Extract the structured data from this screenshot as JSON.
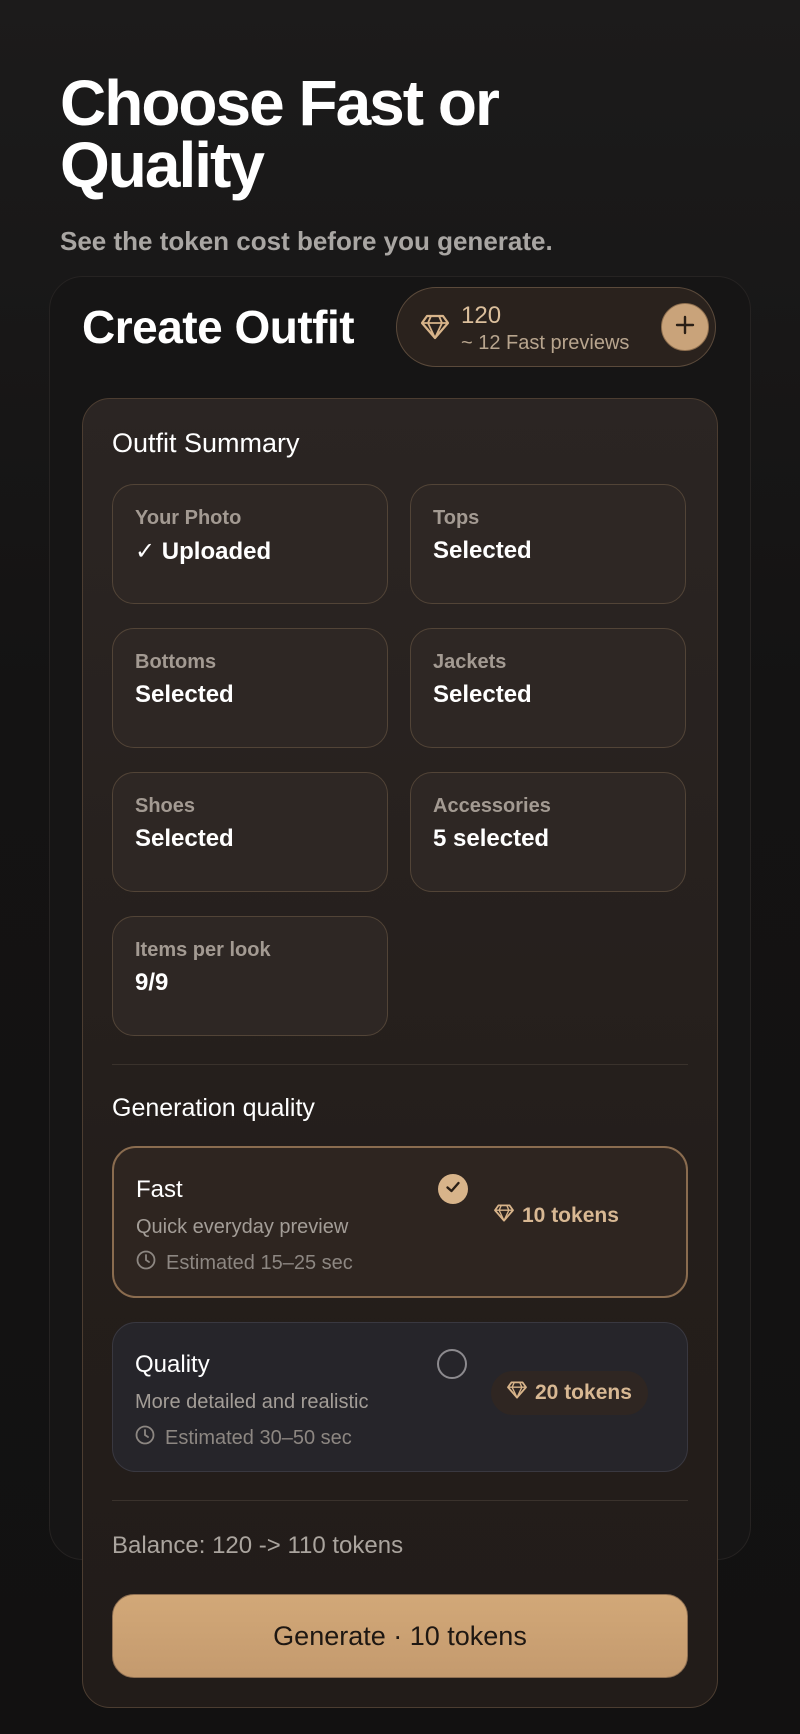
{
  "hero": {
    "title": "Choose Fast or Quality",
    "subtitle": "See the token cost before you generate."
  },
  "screen": {
    "title": "Create Outfit"
  },
  "balance": {
    "amount": "120",
    "note": "~ 12 Fast previews",
    "add_icon": "plus-icon"
  },
  "summary": {
    "title": "Outfit Summary",
    "tiles": [
      {
        "label": "Your Photo",
        "value": "✓ Uploaded"
      },
      {
        "label": "Tops",
        "value": "Selected"
      },
      {
        "label": "Bottoms",
        "value": "Selected"
      },
      {
        "label": "Jackets",
        "value": "Selected"
      },
      {
        "label": "Shoes",
        "value": "Selected"
      },
      {
        "label": "Accessories",
        "value": "5 selected"
      },
      {
        "label": "Items per look",
        "value": "9/9"
      }
    ]
  },
  "quality": {
    "title": "Generation quality",
    "options": [
      {
        "name": "Fast",
        "description": "Quick everyday preview",
        "estimate": "Estimated 15–25 sec",
        "cost": "10 tokens",
        "selected": true
      },
      {
        "name": "Quality",
        "description": "More detailed and realistic",
        "estimate": "Estimated 30–50 sec",
        "cost": "20 tokens",
        "selected": false
      }
    ]
  },
  "footer": {
    "balance_line": "Balance: 120 -> 110 tokens",
    "generate_label": "Generate · 10 tokens"
  },
  "colors": {
    "accent": "#c9a37a",
    "background": "#151414",
    "card": "#2b2523"
  },
  "icons": [
    "diamond-icon",
    "plus-icon",
    "check-icon",
    "clock-icon"
  ]
}
